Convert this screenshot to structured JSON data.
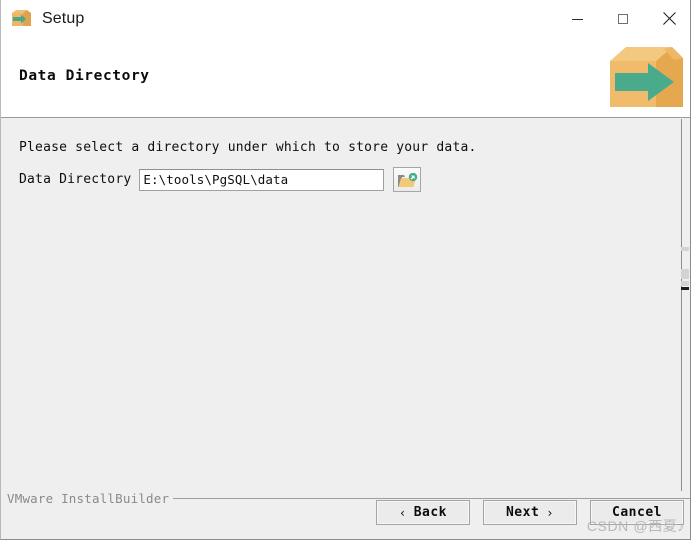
{
  "window": {
    "title": "Setup",
    "app_icon": "installer-box-arrow-icon",
    "controls": {
      "minimize": "minimize-icon",
      "maximize": "maximize-icon",
      "close": "close-icon"
    }
  },
  "header": {
    "title": "Data Directory",
    "logo": "installer-box-arrow-logo"
  },
  "main": {
    "instruction": "Please select a directory under which to store your data.",
    "field": {
      "label": "Data Directory",
      "value": "E:\\tools\\PgSQL\\data",
      "placeholder": "",
      "browse_icon": "open-folder-icon"
    }
  },
  "footer": {
    "brand": "VMware InstallBuilder",
    "buttons": [
      {
        "label": "Back",
        "chevron": "‹",
        "chevron_side": "left"
      },
      {
        "label": "Next",
        "chevron": "›",
        "chevron_side": "right"
      },
      {
        "label": "Cancel",
        "chevron": "",
        "chevron_side": "none"
      }
    ]
  },
  "watermark": {
    "text": "CSDN @西夏♪"
  },
  "colors": {
    "titlebar_bg": "#ffffff",
    "header_bg": "#ffffff",
    "content_bg": "#efefef",
    "border": "#8c8c8c",
    "logo_box": "#eeb358",
    "logo_arrow": "#4caf8f",
    "text": "#0e0e0e",
    "brand_text": "#8a8a8a"
  }
}
